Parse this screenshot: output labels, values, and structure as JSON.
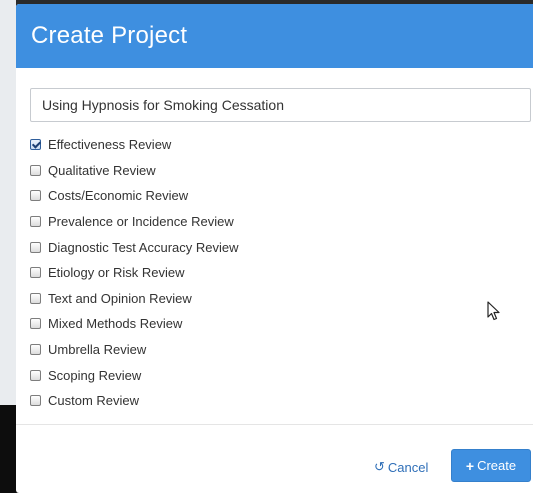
{
  "dialog": {
    "title": "Create Project",
    "project_name": "Using Hypnosis for Smoking Cessation",
    "review_types": [
      {
        "label": "Effectiveness Review",
        "checked": true
      },
      {
        "label": "Qualitative Review",
        "checked": false
      },
      {
        "label": "Costs/Economic Review",
        "checked": false
      },
      {
        "label": "Prevalence or Incidence Review",
        "checked": false
      },
      {
        "label": "Diagnostic Test Accuracy Review",
        "checked": false
      },
      {
        "label": "Etiology or Risk Review",
        "checked": false
      },
      {
        "label": "Text and Opinion Review",
        "checked": false
      },
      {
        "label": "Mixed Methods Review",
        "checked": false
      },
      {
        "label": "Umbrella Review",
        "checked": false
      },
      {
        "label": "Scoping Review",
        "checked": false
      },
      {
        "label": "Custom Review",
        "checked": false
      }
    ],
    "cancel_label": "Cancel",
    "cancel_icon": "undo-icon",
    "create_label": "Create",
    "create_icon": "plus-icon"
  },
  "colors": {
    "header": "#3e8fe0",
    "primary_button": "#3e8fe0",
    "link": "#2f6fb8"
  }
}
